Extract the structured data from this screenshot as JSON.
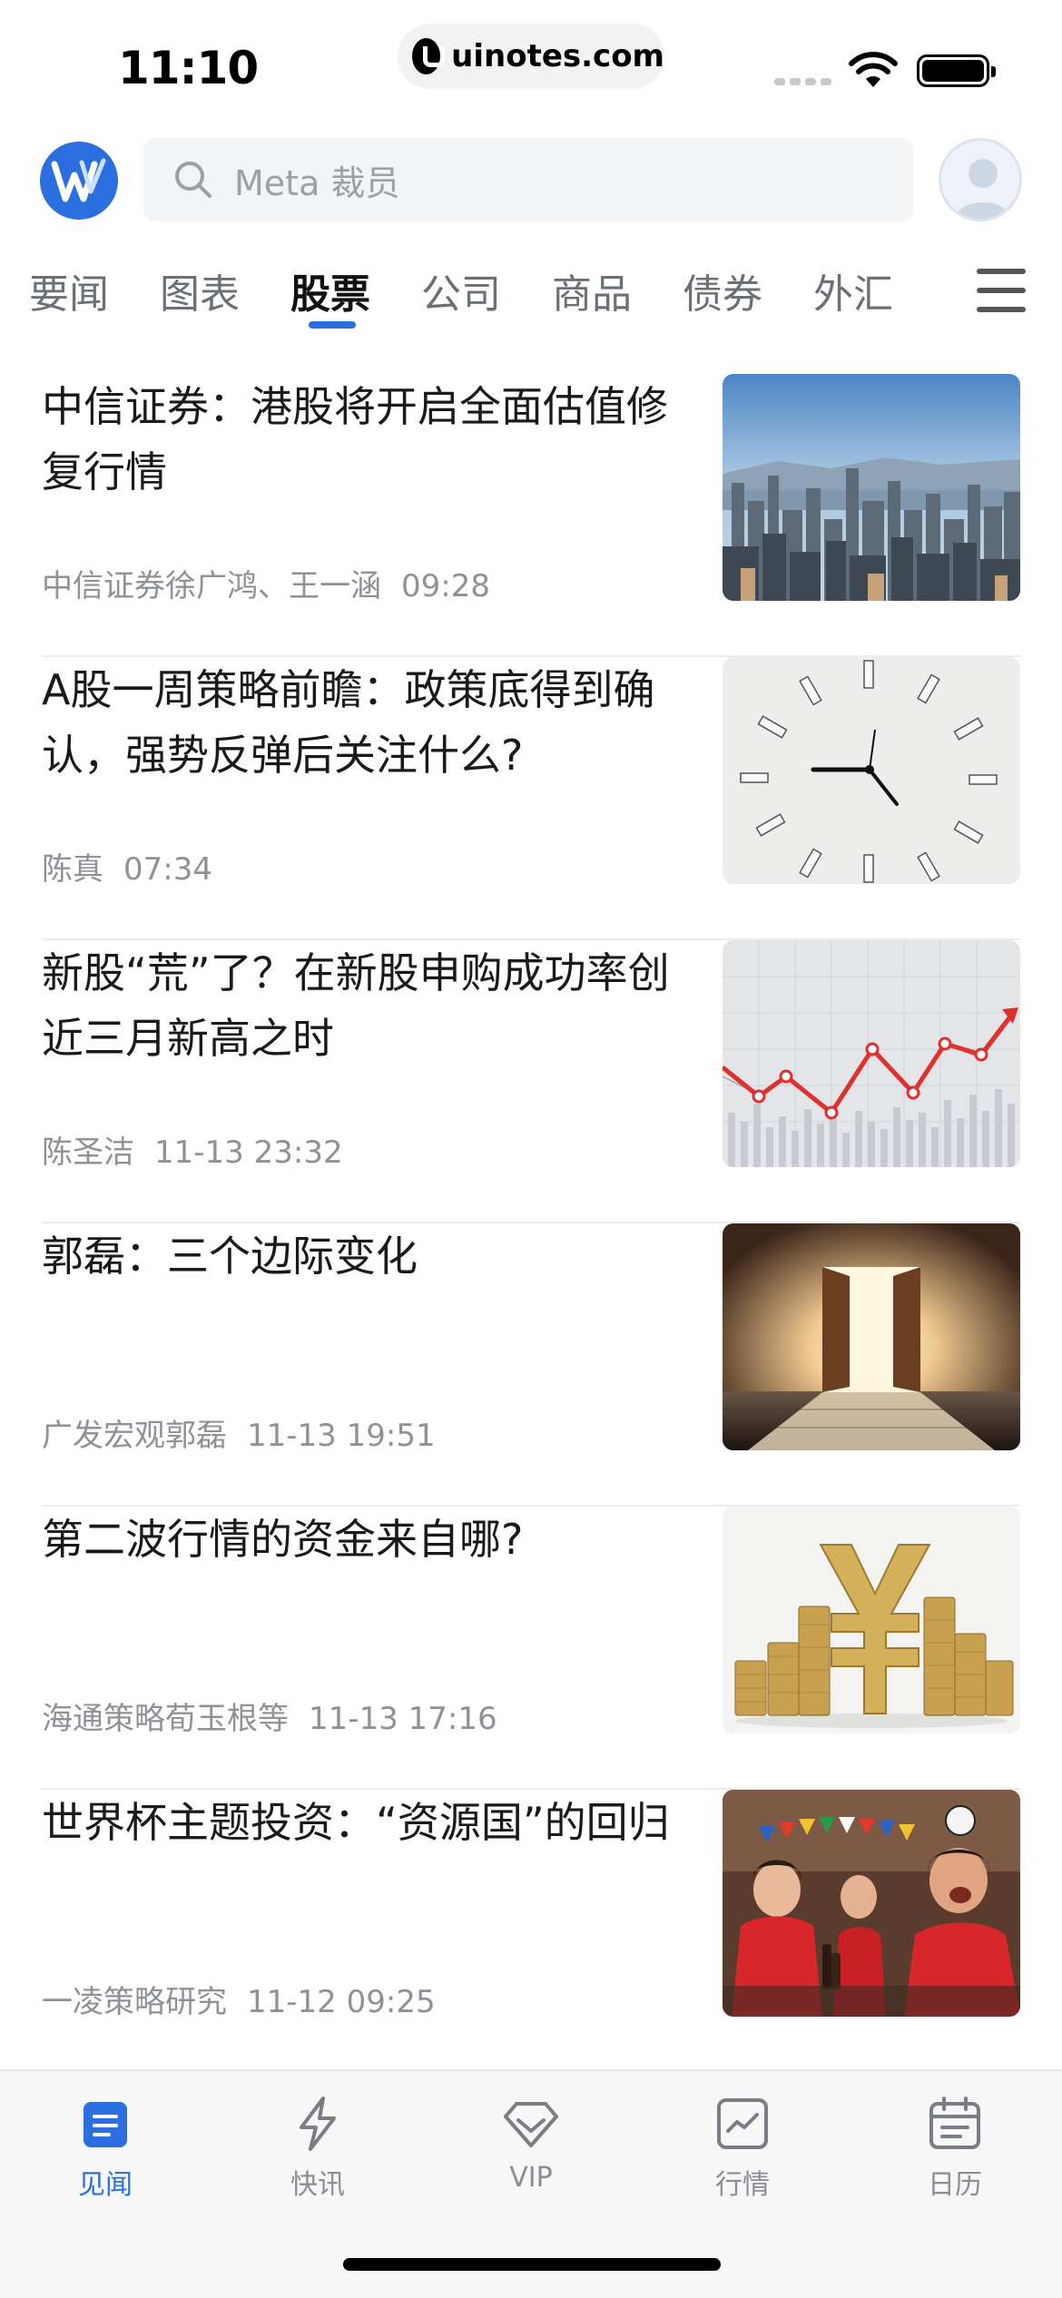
{
  "status_bar": {
    "time": "11:10",
    "url": "uinotes.com"
  },
  "header": {
    "search_placeholder": "Meta 裁员"
  },
  "tabs": [
    {
      "label": "要闻",
      "active": false
    },
    {
      "label": "图表",
      "active": false
    },
    {
      "label": "股票",
      "active": true
    },
    {
      "label": "公司",
      "active": false
    },
    {
      "label": "商品",
      "active": false
    },
    {
      "label": "债券",
      "active": false
    },
    {
      "label": "外汇",
      "active": false
    }
  ],
  "articles": [
    {
      "title": "中信证券：港股将开启全面估值修复行情",
      "source": "中信证券徐广鸿、王一涵",
      "time": "09:28",
      "image": "city-skyline"
    },
    {
      "title": "A股一周策略前瞻：政策底得到确认，强势反弹后关注什么?",
      "source": "陈真",
      "time": "07:34",
      "image": "clock-wall"
    },
    {
      "title": "新股“荒”了？在新股申购成功率创近三月新高之时",
      "source": "陈圣洁",
      "time": "11-13 23:32",
      "image": "rising-chart"
    },
    {
      "title": "郭磊：三个边际变化",
      "source": "广发宏观郭磊",
      "time": "11-13 19:51",
      "image": "open-door"
    },
    {
      "title": "第二波行情的资金来自哪?",
      "source": "海通策略荀玉根等",
      "time": "11-13 17:16",
      "image": "yuan-coins"
    },
    {
      "title": "世界杯主题投资：“资源国”的回归",
      "source": "一凌策略研究",
      "time": "11-12 09:25",
      "image": "football-fans"
    }
  ],
  "bottom_nav": [
    {
      "label": "见闻",
      "icon": "news-icon",
      "active": true
    },
    {
      "label": "快讯",
      "icon": "lightning-icon",
      "active": false
    },
    {
      "label": "VIP",
      "icon": "diamond-icon",
      "active": false
    },
    {
      "label": "行情",
      "icon": "market-chart-icon",
      "active": false
    },
    {
      "label": "日历",
      "icon": "calendar-icon",
      "active": false
    }
  ],
  "colors": {
    "accent": "#2a6ee0",
    "text": "#1a1a1a",
    "meta": "#8e9196"
  }
}
